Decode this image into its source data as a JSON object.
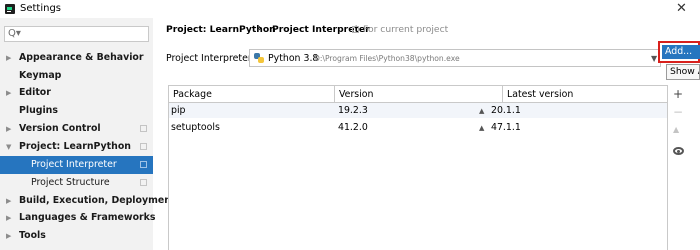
{
  "window": {
    "title": "Settings"
  },
  "sidebar": {
    "search_placeholder": "",
    "items": [
      {
        "label": "Appearance & Behavior",
        "has_arrow": true,
        "arrow": "▶"
      },
      {
        "label": "Keymap",
        "has_arrow": false
      },
      {
        "label": "Editor",
        "has_arrow": true,
        "arrow": "▶"
      },
      {
        "label": "Plugins",
        "has_arrow": false
      },
      {
        "label": "Version Control",
        "has_arrow": true,
        "arrow": "▶"
      },
      {
        "label": "Project: LearnPython",
        "has_arrow": true,
        "arrow": "▼"
      },
      {
        "label": "Project Interpreter",
        "selected": true
      },
      {
        "label": "Project Structure"
      },
      {
        "label": "Build, Execution, Deployment",
        "has_arrow": true,
        "arrow": "▶"
      },
      {
        "label": "Languages & Frameworks",
        "has_arrow": true,
        "arrow": "▶"
      },
      {
        "label": "Tools",
        "has_arrow": true,
        "arrow": "▶"
      }
    ]
  },
  "breadcrumb": {
    "project": "Project: LearnPython",
    "separator": "›",
    "page": "Project Interpreter",
    "hint": "For current project"
  },
  "interpreter": {
    "label": "Project Interpreter:",
    "name": "Python 3.8",
    "path": "D:\\Program Files\\Python38\\python.exe"
  },
  "add_button": {
    "label": "Add..."
  },
  "tooltip": {
    "text": "Show All"
  },
  "packages": {
    "columns": [
      "Package",
      "Version",
      "Latest version"
    ],
    "rows": [
      {
        "package": "pip",
        "version": "19.2.3",
        "latest": "20.1.1"
      },
      {
        "package": "setuptools",
        "version": "41.2.0",
        "latest": "47.1.1"
      }
    ]
  },
  "toolbar": {
    "add_symbol": "+",
    "remove_symbol": "−",
    "upgrade_symbol": "▲"
  },
  "colors": {
    "accent": "#2675bf",
    "highlight_border": "#d8201c",
    "sidebar_bg": "#f2f2f2"
  }
}
